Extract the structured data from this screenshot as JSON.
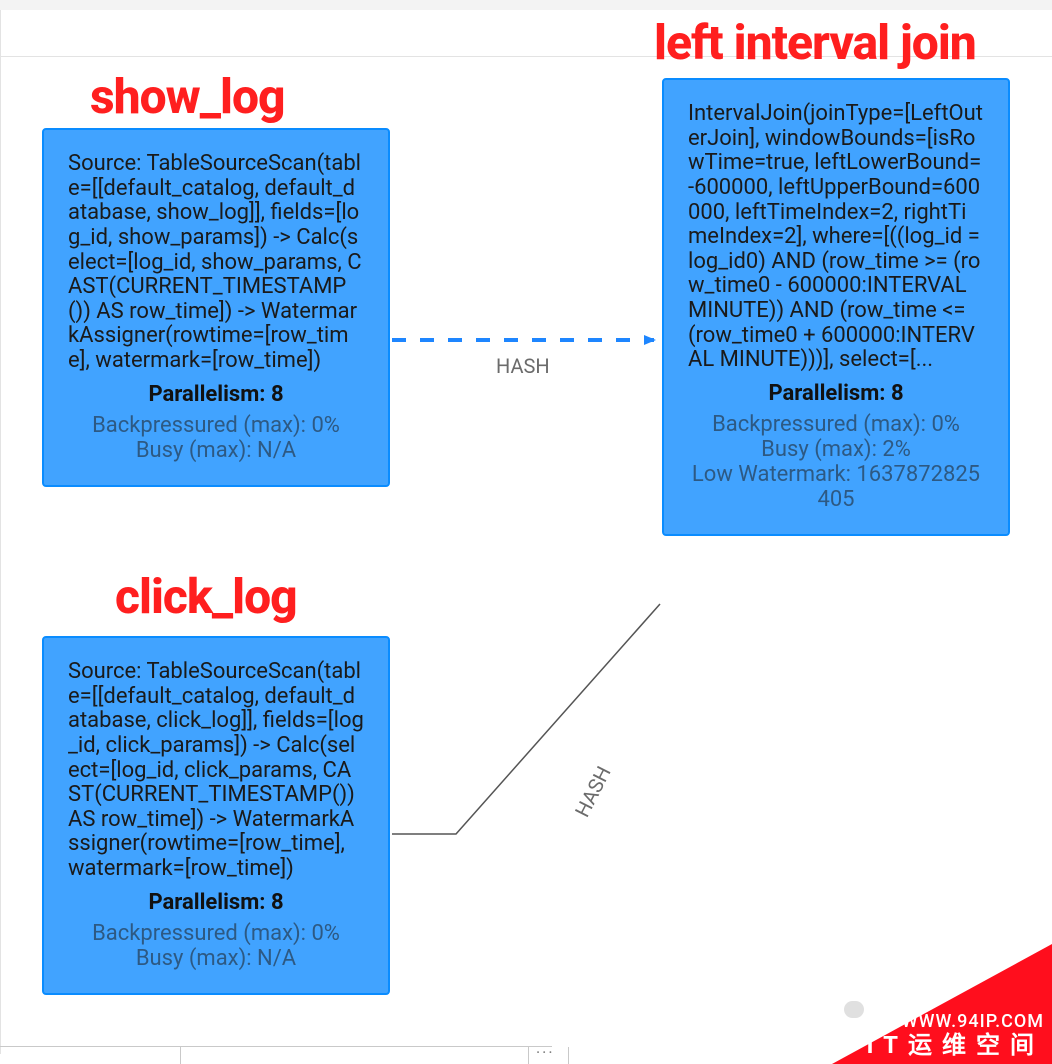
{
  "headings": {
    "show_log": "show_log",
    "click_log": "click_log",
    "left_interval_join": "left interval join"
  },
  "nodes": {
    "show_log": {
      "body": "Source: TableSourceScan(table=[[default_catalog, default_database, show_log]], fields=[log_id, show_params]) -> Calc(select=[log_id, show_params, CAST(CURRENT_TIMESTAMP()) AS row_time]) -> WatermarkAssigner(rowtime=[row_time], watermark=[row_time])",
      "parallelism": "Parallelism: 8",
      "backpressure": "Backpressured (max): 0%",
      "busy": "Busy (max): N/A"
    },
    "click_log": {
      "body": "Source: TableSourceScan(table=[[default_catalog, default_database, click_log]], fields=[log_id, click_params]) -> Calc(select=[log_id, click_params, CAST(CURRENT_TIMESTAMP()) AS row_time]) -> WatermarkAssigner(rowtime=[row_time], watermark=[row_time])",
      "parallelism": "Parallelism: 8",
      "backpressure": "Backpressured (max): 0%",
      "busy": "Busy (max): N/A"
    },
    "interval_join": {
      "body": "IntervalJoin(joinType=[LeftOuterJoin], windowBounds=[isRowTime=true, leftLowerBound=-600000, leftUpperBound=600000, leftTimeIndex=2, rightTimeIndex=2], where=[((log_id = log_id0) AND (row_time >= (row_time0 - 600000:INTERVAL MINUTE)) AND (row_time <= (row_time0 + 600000:INTERVAL MINUTE)))], select=[...",
      "parallelism": "Parallelism: 8",
      "backpressure": "Backpressured (max): 0%",
      "busy": "Busy (max): 2%",
      "low_watermark": "Low Watermark: 1637872825405"
    }
  },
  "edges": {
    "show_to_join": "HASH",
    "click_to_join": "HASH"
  },
  "watermark": {
    "url": "WWW.94IP.COM",
    "name": "IT运维空间"
  }
}
